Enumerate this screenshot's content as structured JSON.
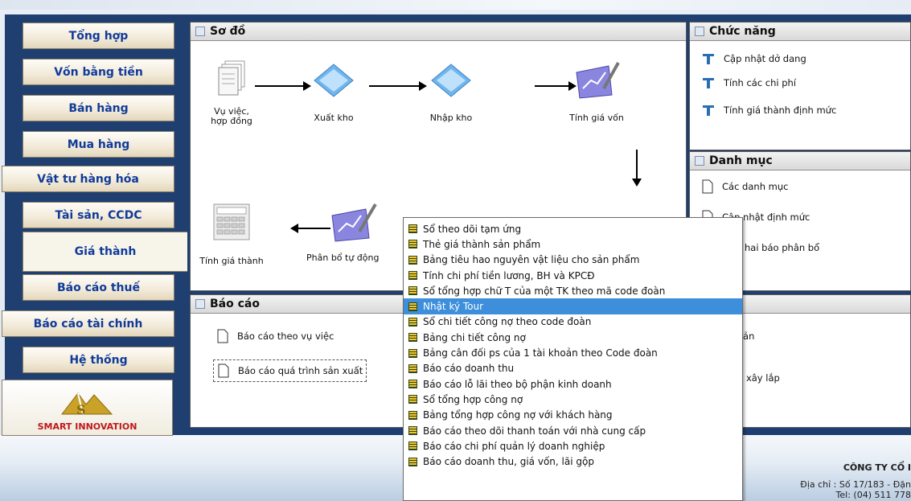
{
  "sidebar": {
    "tabs": [
      "Tổng hợp",
      "Vốn bằng tiền",
      "Bán hàng",
      "Mua hàng",
      "Vật tư hàng hóa",
      "Tài sản, CCDC",
      "Giá thành",
      "Báo cáo thuế",
      "Báo cáo tài chính",
      "Hệ thống"
    ],
    "active": "Giá thành",
    "logo_text": "SMART INNOVATION"
  },
  "diagram": {
    "title": "Sơ đồ",
    "nodes": [
      "Vụ việc, hợp đồng",
      "Xuất kho",
      "Nhập kho",
      "Tính giá vốn",
      "Tính giá thành",
      "Phân bổ tự động"
    ]
  },
  "functions": {
    "title": "Chức năng",
    "items": [
      "Cập nhật dở dang",
      "Tính các chi phí",
      "Tính giá thành định mức"
    ]
  },
  "catalog": {
    "title": "Danh mục",
    "items": [
      "Các danh mục",
      "Cập nhật định mức",
      "hai báo phân bổ"
    ]
  },
  "reports": {
    "title": "Báo cáo",
    "items": [
      "Báo cáo theo vụ việc",
      "Báo cáo quá trình sản xuất"
    ],
    "right_items": [
      "oản",
      "n xây lắp"
    ]
  },
  "menu": {
    "selected": "Nhật ký Tour",
    "items": [
      "Sổ theo dõi tạm ứng",
      "Thẻ giá thành sản phẩm",
      "Bảng tiêu hao nguyên vật liệu cho sản phẩm",
      "Tính chi phí tiền lương, BH và KPCĐ",
      "Sổ tổng hợp chữ T của một TK theo mã code đoàn",
      "Nhật ký Tour",
      "Sổ chi tiết công nợ theo code đoàn",
      "Bảng chi tiết công nợ",
      "Bảng cân đối ps của 1 tài khoản theo Code đoàn",
      "Báo cáo doanh thu",
      "Báo cáo lỗ lãi theo bộ phận kinh doanh",
      "Sổ tổng hợp công nợ",
      "Bảng tổng hợp công nợ với khách hàng",
      "Báo cáo theo dõi thanh toán với nhà cung cấp",
      "Báo cáo chi phí quản lý doanh nghiệp",
      "Báo cáo doanh thu, giá vốn, lãi gộp"
    ]
  },
  "footer": {
    "company": "CÔNG TY CỔ I",
    "address": "Địa chỉ : Số 17/183 - Đặn",
    "phone": "Tel: (04) 511 778"
  },
  "colors": {
    "frame": "#1e3f70",
    "tab_text": "#103b9a",
    "menu_selected": "#3d8fdb",
    "logo_text": "#c01818"
  }
}
